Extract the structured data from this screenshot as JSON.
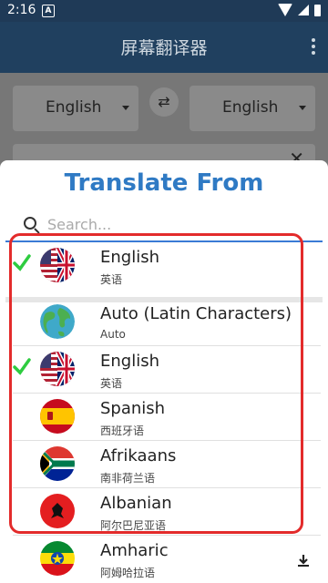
{
  "status_bar": {
    "time": "2:16",
    "notification": "A"
  },
  "app_bar": {
    "title": "屏幕翻译器"
  },
  "main": {
    "source_language": "English",
    "target_language": "English"
  },
  "sheet": {
    "title": "Translate From",
    "search_placeholder": "Search..."
  },
  "languages": [
    {
      "name": "English",
      "native": "英语",
      "selected": true,
      "flag": "us-uk"
    },
    {
      "name": "Auto (Latin Characters)",
      "native": "Auto",
      "selected": false,
      "flag": "globe"
    },
    {
      "name": "English",
      "native": "英语",
      "selected": true,
      "flag": "us-uk"
    },
    {
      "name": "Spanish",
      "native": "西班牙语",
      "selected": false,
      "flag": "spain"
    },
    {
      "name": "Afrikaans",
      "native": "南非荷兰语",
      "selected": false,
      "flag": "south-africa"
    },
    {
      "name": "Albanian",
      "native": "阿尔巴尼亚语",
      "selected": false,
      "flag": "albania"
    },
    {
      "name": "Amharic",
      "native": "阿姆哈拉语",
      "selected": false,
      "flag": "ethiopia",
      "downloadable": true
    }
  ],
  "colors": {
    "accent": "#2f7ac4",
    "check": "#2ecc40",
    "highlight": "#e32b2b"
  }
}
